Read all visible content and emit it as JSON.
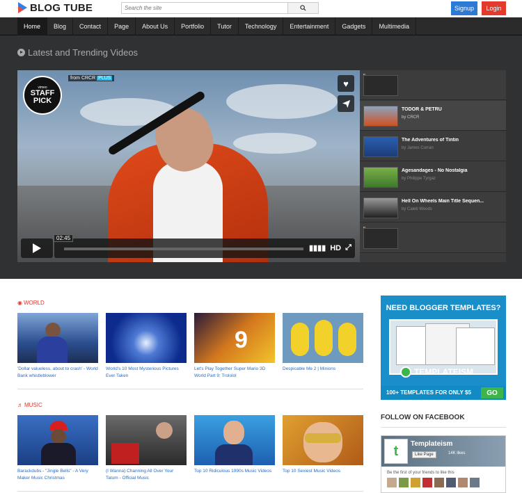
{
  "header": {
    "logo_text": "BLOG TUBE",
    "search_placeholder": "Search the site",
    "signup_label": "Signup",
    "login_label": "Login"
  },
  "nav": {
    "items": [
      "Home",
      "Blog",
      "Contact",
      "Page",
      "About Us",
      "Portfolio",
      "Tutor",
      "Technology",
      "Entertainment",
      "Gadgets",
      "Multimedia"
    ],
    "active": "Home"
  },
  "feature": {
    "title": "Latest and Trending Videos",
    "player": {
      "staff_pick_small": "vimeo",
      "staff_pick_big_1": "STAFF",
      "staff_pick_big_2": "PICK",
      "from_text": "from CRCR",
      "plus_text": "PLUS",
      "time": "02:45",
      "hd_label": "HD"
    },
    "playlist": [
      {
        "title": "\"",
        "by": ""
      },
      {
        "title": "TODOR & PETRU",
        "by": "by CRCR"
      },
      {
        "title": "The Adventures of Tintin",
        "by": "by James Curran"
      },
      {
        "title": "Agesandages - No Nostalgia",
        "by": "by Philippe Tyrgaz"
      },
      {
        "title": "Hell On Wheels Main Title Sequen...",
        "by": "by Caleb Woods"
      },
      {
        "title": "\"",
        "by": ""
      }
    ]
  },
  "sections": [
    {
      "label": "WORLD",
      "cards": [
        {
          "title": "'Dollar valueless, about to crash' - World Bank whistleblower"
        },
        {
          "title": "World's 10 Most Mysterious Pictures Ever Taken"
        },
        {
          "title": "Let's Play Together Super Mario 3D World Part 9: Trololol"
        },
        {
          "title": "Despicable Me 2 | Minions"
        }
      ]
    },
    {
      "label": "MUSIC",
      "cards": [
        {
          "title": "Barackdubs - \"Jingle Bells\" - A Very Maker Music Christmas"
        },
        {
          "title": "(I Wanna) Channing All Over Your Tatum - Official Music"
        },
        {
          "title": "Top 10 Ridiculous 1990s Music Videos"
        },
        {
          "title": "Top 10 Sexiest Music Videos"
        }
      ]
    }
  ],
  "sidebar": {
    "ad_heading": "NEED BLOGGER TEMPLATES?",
    "ad_brand": "TEMPLATEISM",
    "ad_footer": "100+ TEMPLATES FOR ONLY $5",
    "ad_go": "GO",
    "follow_title": "FOLLOW ON FACEBOOK",
    "fb_name": "Templateism",
    "fb_like": "Like Page",
    "fb_likes": "14K likes",
    "fb_friends": "Be the first of your friends to like this"
  },
  "colors": {
    "accent_red": "#e2352b",
    "signup_blue": "#2c7ad6",
    "login_red": "#e23b2e",
    "link_blue": "#2a6cc4",
    "nav_bg": "#2b2b2b",
    "feature_bg": "#303133"
  }
}
